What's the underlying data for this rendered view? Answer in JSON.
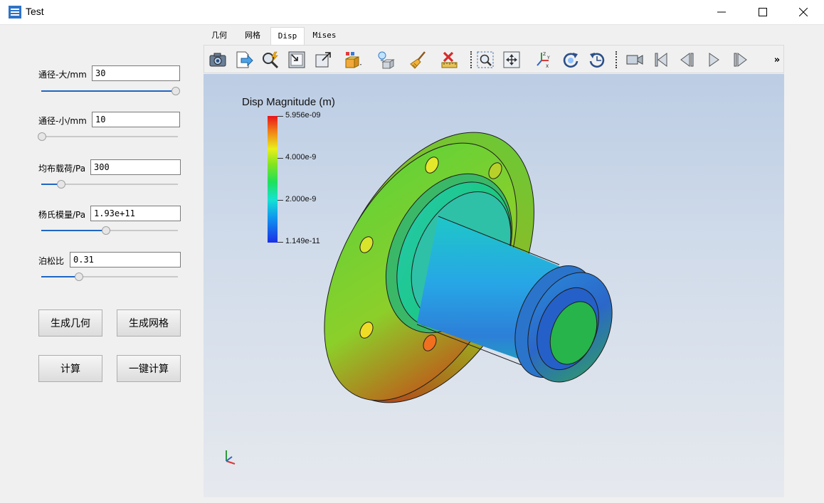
{
  "window": {
    "title": "Test"
  },
  "params": [
    {
      "label": "通径-大/mm",
      "value": "30",
      "slider": 0.98
    },
    {
      "label": "通径-小/mm",
      "value": "10",
      "slider": 0.0
    },
    {
      "label": "均布载荷/Pa",
      "value": "300",
      "slider": 0.14
    },
    {
      "label": "杨氏模量/Pa",
      "value": "1.93e+11",
      "slider": 0.47
    },
    {
      "label": "泊松比",
      "value": "0.31",
      "slider": 0.27
    }
  ],
  "buttons": {
    "gen_geometry": "生成几何",
    "gen_mesh": "生成网格",
    "compute": "计算",
    "one_click": "一键计算"
  },
  "tabs": [
    "几何",
    "网格",
    "Disp",
    "Mises"
  ],
  "toolbar": {
    "overflow": "»"
  },
  "legend": {
    "title": "Disp Magnitude (m)",
    "max": "5.956e-09",
    "mid_high": "4.000e-9",
    "mid_low": "2.000e-9",
    "min": "1.149e-11"
  },
  "colors": {
    "accent": "#1f66c4",
    "viewport_top": "#bccde4",
    "viewport_bottom": "#e6e9ee"
  }
}
